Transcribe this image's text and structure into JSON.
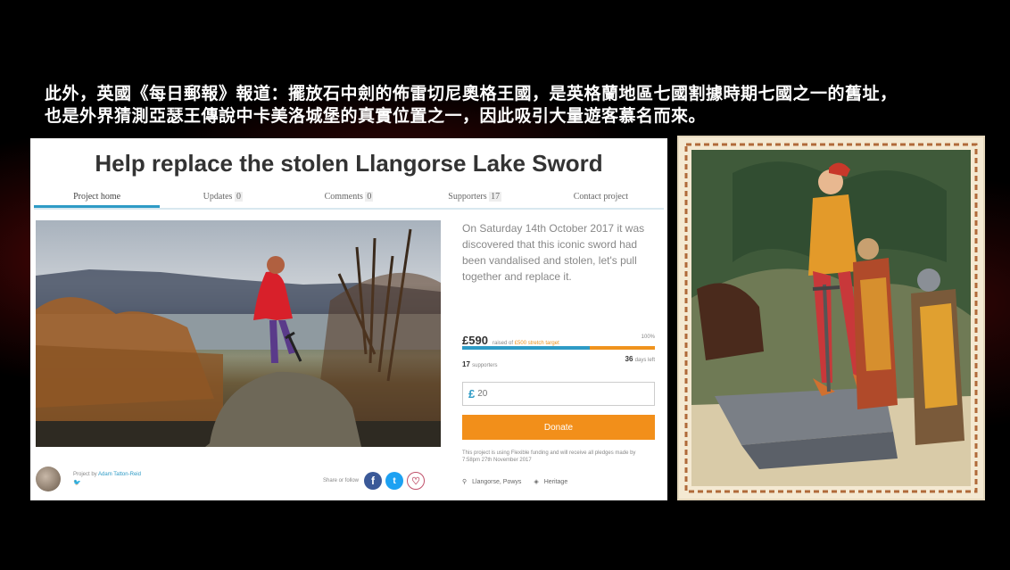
{
  "caption": {
    "line1": "此外，英國《每日郵報》報道：擺放石中劍的佈雷切尼奧格王國，是英格蘭地區七國割據時期七國之一的舊址，",
    "line2": "也是外界猜測亞瑟王傳說中卡美洛城堡的真實位置之一，因此吸引大量遊客慕名而來。"
  },
  "project": {
    "title": "Help replace the stolen Llangorse Lake Sword",
    "tabs": [
      {
        "label": "Project home",
        "count": ""
      },
      {
        "label": "Updates",
        "count": "0"
      },
      {
        "label": "Comments",
        "count": "0"
      },
      {
        "label": "Supporters",
        "count": "17"
      },
      {
        "label": "Contact project",
        "count": ""
      }
    ],
    "description": "On Saturday 14th October 2017 it was discovered that this iconic sword had been vandalised and stolen, let's pull together and replace it.",
    "raised": "£590",
    "raised_of": "raised of",
    "target": "£500 stretch target",
    "percent_label": "100%",
    "progress_fraction": 0.66,
    "supporters_count": "17",
    "supporters_label": "supporters",
    "days_count": "36",
    "days_label": "days left",
    "currency_symbol": "£",
    "pledge_placeholder": "20",
    "donate_label": "Donate",
    "funding_note": "This project is using Flexible funding and will receive all pledges made by 7:58pm 27th November 2017",
    "location": "Llangorse, Powys",
    "category": "Heritage",
    "project_by": "Project by",
    "creator": "Adam Tatton-Reid",
    "share_label": "Share or follow",
    "colors": {
      "accent": "#2e9bc6",
      "donate": "#f28f1a",
      "facebook": "#3b5998",
      "twitter": "#1da1f2"
    }
  }
}
